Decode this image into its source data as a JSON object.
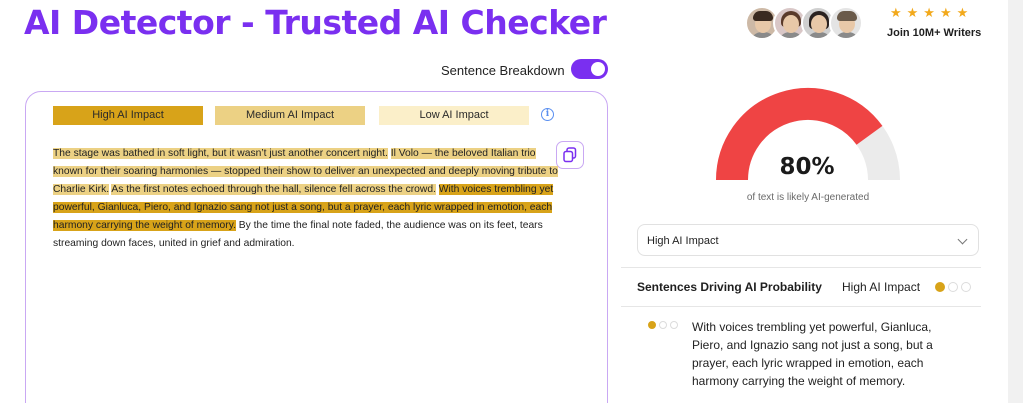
{
  "header": {
    "title": "AI Detector - Trusted AI Checker",
    "rating": "★★★★★",
    "join_text": "Join 10M+ Writers"
  },
  "controls": {
    "sentence_breakdown_label": "Sentence Breakdown",
    "sentence_breakdown_on": true
  },
  "legend": {
    "high": "High AI Impact",
    "medium": "Medium AI Impact",
    "low": "Low AI Impact",
    "colors": {
      "high": "#d8a319",
      "medium": "#ecd184",
      "low": "#fbefc9"
    }
  },
  "text_segments": [
    {
      "text": "The stage was bathed in soft light, but it wasn’t just another concert night.",
      "impact": "medium"
    },
    {
      "text": " ",
      "impact": "none"
    },
    {
      "text": "Il Volo — the beloved Italian trio known for their soaring harmonies — stopped their show to deliver an unexpected and deeply moving tribute to Charlie Kirk.",
      "impact": "medium"
    },
    {
      "text": " ",
      "impact": "none"
    },
    {
      "text": "As the first notes echoed through the hall, silence fell across the crowd.",
      "impact": "medium"
    },
    {
      "text": " ",
      "impact": "none"
    },
    {
      "text": "With voices trembling yet powerful, Gianluca, Piero, and Ignazio sang not just a song, but a prayer, each lyric wrapped in emotion, each harmony carrying the weight of memory.",
      "impact": "high"
    },
    {
      "text": " By the time the final note faded, the audience was on its feet, tears streaming down faces, united in grief and admiration.",
      "impact": "none"
    }
  ],
  "result": {
    "ai_percent": 80,
    "percent_label": "80%",
    "caption": "of text is likely AI-generated",
    "gauge_colors": {
      "ai": "#ef4444",
      "human": "#ebebeb"
    }
  },
  "impact_select": {
    "value": "High AI Impact"
  },
  "driving": {
    "title": "Sentences Driving AI Probability",
    "filter_label": "High AI Impact",
    "filter_level": 1,
    "items": [
      {
        "level": 1,
        "text": "With voices trembling yet powerful, Gianluca, Piero, and Ignazio sang not just a song, but a prayer, each lyric wrapped in emotion, each harmony carrying the weight of memory."
      }
    ]
  },
  "accent_color": "#7a2ff0"
}
